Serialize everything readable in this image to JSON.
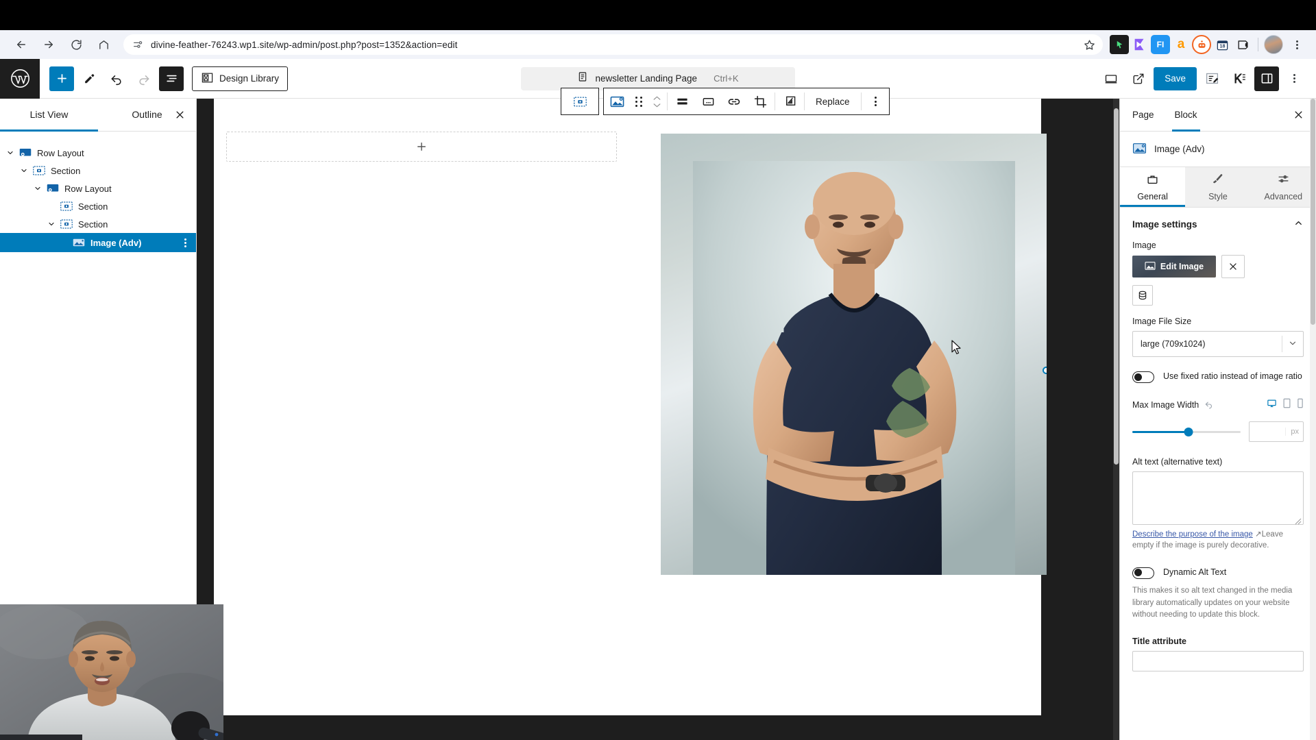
{
  "browser": {
    "url": "divine-feather-76243.wp1.site/wp-admin/post.php?post=1352&action=edit",
    "back_icon": "back-arrow-icon",
    "forward_icon": "forward-arrow-icon",
    "reload_icon": "reload-icon",
    "home_icon": "home-icon",
    "site_info_icon": "site-settings-icon",
    "bookmark_icon": "star-icon",
    "extensions": [
      {
        "name": "cursor-extension",
        "color": "#1b1b1b",
        "glyph": "➤"
      },
      {
        "name": "send-extension",
        "color": "#8b5cf6",
        "glyph": "➤"
      },
      {
        "name": "figma-extension",
        "color": "#2196f3",
        "glyph": "FI"
      },
      {
        "name": "amazon-extension",
        "color": "#ff9900",
        "glyph": "a"
      },
      {
        "name": "bot-extension",
        "color": "#f26522",
        "glyph": "●"
      },
      {
        "name": "calendar-extension",
        "color": "#1565c0",
        "glyph": "18"
      },
      {
        "name": "clipboard-extension",
        "color": "#ffffff",
        "glyph": "⬚"
      }
    ]
  },
  "editor_header": {
    "wp_logo": "wordpress-logo",
    "add_block_label": "+",
    "tools": [
      {
        "name": "add-block-button",
        "icon": "plus-icon"
      },
      {
        "name": "edit-tool-button",
        "icon": "pencil-icon"
      },
      {
        "name": "undo-button",
        "icon": "undo-icon"
      },
      {
        "name": "redo-button",
        "icon": "redo-icon"
      },
      {
        "name": "list-view-button",
        "icon": "list-view-icon"
      }
    ],
    "design_library_label": "Design Library",
    "document_title": "newsletter Landing Page",
    "command_shortcut": "Ctrl+K",
    "save_label": "Save",
    "right_tools": [
      {
        "name": "view-desktop-button",
        "icon": "desktop-icon"
      },
      {
        "name": "preview-external-button",
        "icon": "external-link-icon"
      },
      {
        "name": "edit-mode-button",
        "icon": "edit-note-icon"
      },
      {
        "name": "kadence-button",
        "icon": "kadence-icon"
      },
      {
        "name": "settings-sidebar-button",
        "icon": "sidebar-panel-icon"
      },
      {
        "name": "more-options-button",
        "icon": "three-dots-vertical-icon"
      }
    ],
    "accent_color": "#007cba"
  },
  "list_view": {
    "tabs": [
      {
        "label": "List View",
        "active": true
      },
      {
        "label": "Outline",
        "active": false
      }
    ],
    "close_icon": "close-icon",
    "rows": [
      {
        "label": "Row Layout",
        "depth": 0,
        "icon": "row-layout-icon",
        "expanded": true,
        "selected": false
      },
      {
        "label": "Section",
        "depth": 1,
        "icon": "section-icon",
        "expanded": true,
        "selected": false
      },
      {
        "label": "Row Layout",
        "depth": 2,
        "icon": "row-layout-icon",
        "expanded": true,
        "selected": false
      },
      {
        "label": "Section",
        "depth": 3,
        "icon": "section-icon",
        "expanded": false,
        "selected": false
      },
      {
        "label": "Section",
        "depth": 2,
        "icon": "section-icon",
        "expanded": true,
        "selected": false
      },
      {
        "label": "Image (Adv)",
        "depth": 3,
        "icon": "image-adv-icon",
        "expanded": false,
        "selected": true
      }
    ]
  },
  "block_toolbar": {
    "parent_block_icon": "section-icon",
    "buttons": [
      {
        "name": "block-type-image-button",
        "icon": "image-icon"
      },
      {
        "name": "drag-handle",
        "icon": "drag-dots-icon"
      },
      {
        "name": "move-up-down-buttons",
        "icon": "move-arrows-icon"
      },
      {
        "name": "align-button",
        "icon": "align-icon"
      },
      {
        "name": "caption-button",
        "icon": "caption-icon"
      },
      {
        "name": "link-button",
        "icon": "link-icon"
      },
      {
        "name": "crop-button",
        "icon": "crop-icon"
      },
      {
        "name": "duotone-filter-button",
        "icon": "duotone-icon"
      }
    ],
    "replace_label": "Replace",
    "more_options_icon": "three-dots-vertical-icon"
  },
  "canvas": {
    "appender_icon": "plus-icon",
    "selection_handle": "resize-handle"
  },
  "settings_panel": {
    "tabs": [
      {
        "label": "Page",
        "active": false
      },
      {
        "label": "Block",
        "active": true
      }
    ],
    "close_icon": "close-icon",
    "block_name": "Image (Adv)",
    "block_icon": "image-adv-icon",
    "subtabs": [
      {
        "label": "General",
        "icon": "general-icon",
        "active": true
      },
      {
        "label": "Style",
        "icon": "brush-icon",
        "active": false
      },
      {
        "label": "Advanced",
        "icon": "sliders-icon",
        "active": false
      }
    ],
    "image_settings": {
      "section_title": "Image settings",
      "collapse_icon": "chevron-up-icon",
      "image_label": "Image",
      "edit_image_label": "Edit Image",
      "edit_image_icon": "image-icon",
      "remove_icon": "close-icon",
      "media_library_icon": "database-icon",
      "file_size_label": "Image File Size",
      "file_size_value": "large (709x1024)",
      "file_size_caret": "chevron-down-icon",
      "fixed_ratio_label": "Use fixed ratio instead of image ratio",
      "fixed_ratio_on": false,
      "max_width_label": "Max Image Width",
      "max_width_reset_icon": "undo-icon",
      "devices": [
        {
          "name": "desktop-icon",
          "active": true
        },
        {
          "name": "tablet-icon",
          "active": false
        },
        {
          "name": "mobile-icon",
          "active": false
        }
      ],
      "max_width_value": "",
      "max_width_unit": "px",
      "alt_text_label": "Alt text (alternative text)",
      "alt_text_value": "",
      "alt_help_link": "Describe the purpose of the image",
      "alt_help_suffix": "Leave empty if the image is purely decorative.",
      "dynamic_alt_label": "Dynamic Alt Text",
      "dynamic_alt_on": false,
      "dynamic_alt_desc": "This makes it so alt text changed in the media library automatically updates on your website without needing to update this block.",
      "title_attribute_label": "Title attribute"
    }
  },
  "webcam": {
    "name": "webcam-overlay"
  }
}
